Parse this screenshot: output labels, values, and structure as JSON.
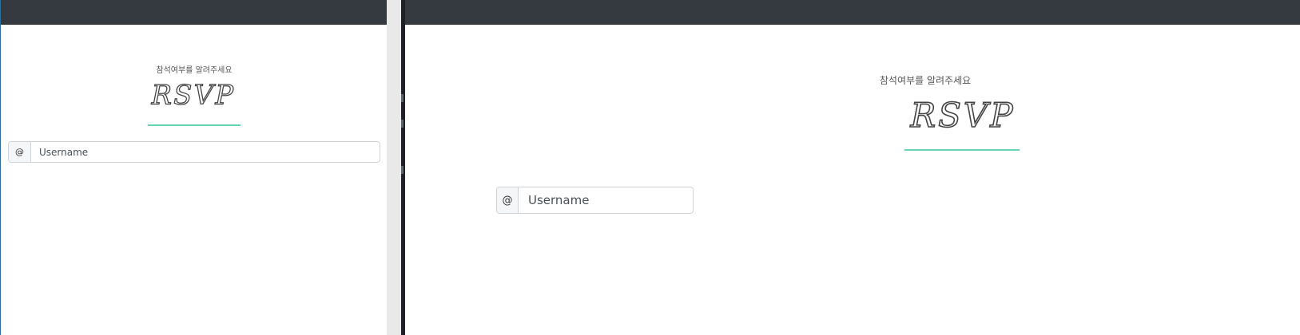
{
  "panels": {
    "left": {
      "subtitle": "참석여부를 알려주세요",
      "title": "RSVP",
      "input_addon": "@",
      "input_placeholder": "Username",
      "input_value": ""
    },
    "right": {
      "subtitle": "참석여부를 알려주세요",
      "title": "RSVP",
      "input_addon": "@",
      "input_placeholder": "Username",
      "input_value": ""
    }
  },
  "colors": {
    "topbar": "#343a40",
    "accent_rule": "#66d2b4",
    "text": "#555555"
  },
  "icons": {
    "title_style": "script-lettering"
  }
}
